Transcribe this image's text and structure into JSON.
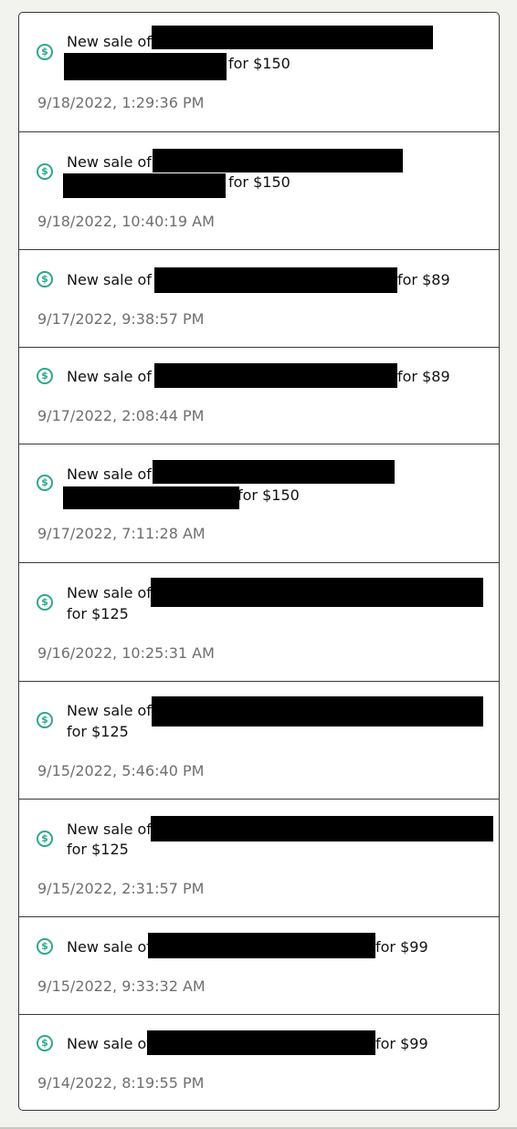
{
  "notifications": [
    {
      "prefix": "New sale of",
      "price": "for $150",
      "time": "9/18/2022, 1:29:36 PM"
    },
    {
      "prefix": "New sale of",
      "price": "for $150",
      "time": "9/18/2022, 10:40:19 AM"
    },
    {
      "prefix": "New sale of",
      "price": "for $89",
      "time": "9/17/2022, 9:38:57 PM"
    },
    {
      "prefix": "New sale of",
      "price": "for $89",
      "time": "9/17/2022, 2:08:44 PM"
    },
    {
      "prefix": "New sale of",
      "price": "for $150",
      "time": "9/17/2022, 7:11:28 AM"
    },
    {
      "prefix": "New sale of",
      "price": "for $125",
      "time": "9/16/2022, 10:25:31 AM"
    },
    {
      "prefix": "New sale of",
      "price": "for $125",
      "time": "9/15/2022, 5:46:40 PM"
    },
    {
      "prefix": "New sale of",
      "price": "for $125",
      "time": "9/15/2022, 2:31:57 PM"
    },
    {
      "prefix": "New sale of",
      "price": "for $99",
      "time": "9/15/2022, 9:33:32 AM"
    },
    {
      "prefix": "New sale of",
      "price": "for $99",
      "time": "9/14/2022, 8:19:55 PM"
    }
  ],
  "icon": {
    "name": "dollar-circle-icon",
    "glyph": "$",
    "color": "#2fa68f"
  }
}
